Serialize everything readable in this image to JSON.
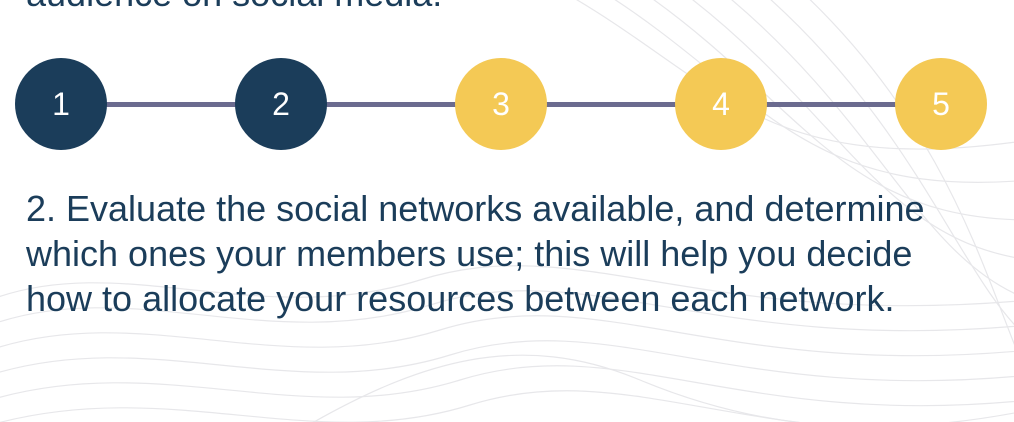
{
  "previous_text": "audience on social media.",
  "colors": {
    "navy": "#1b3d5a",
    "gold": "#f4c955",
    "connector": "#6b6b8f"
  },
  "steps": [
    {
      "label": "1",
      "status": "completed"
    },
    {
      "label": "2",
      "status": "current"
    },
    {
      "label": "3",
      "status": "upcoming"
    },
    {
      "label": "4",
      "status": "upcoming"
    },
    {
      "label": "5",
      "status": "upcoming"
    }
  ],
  "description": "2. Evaluate the social networks available, and determine which ones your members use; this will help you decide how to allocate your resources between each network."
}
